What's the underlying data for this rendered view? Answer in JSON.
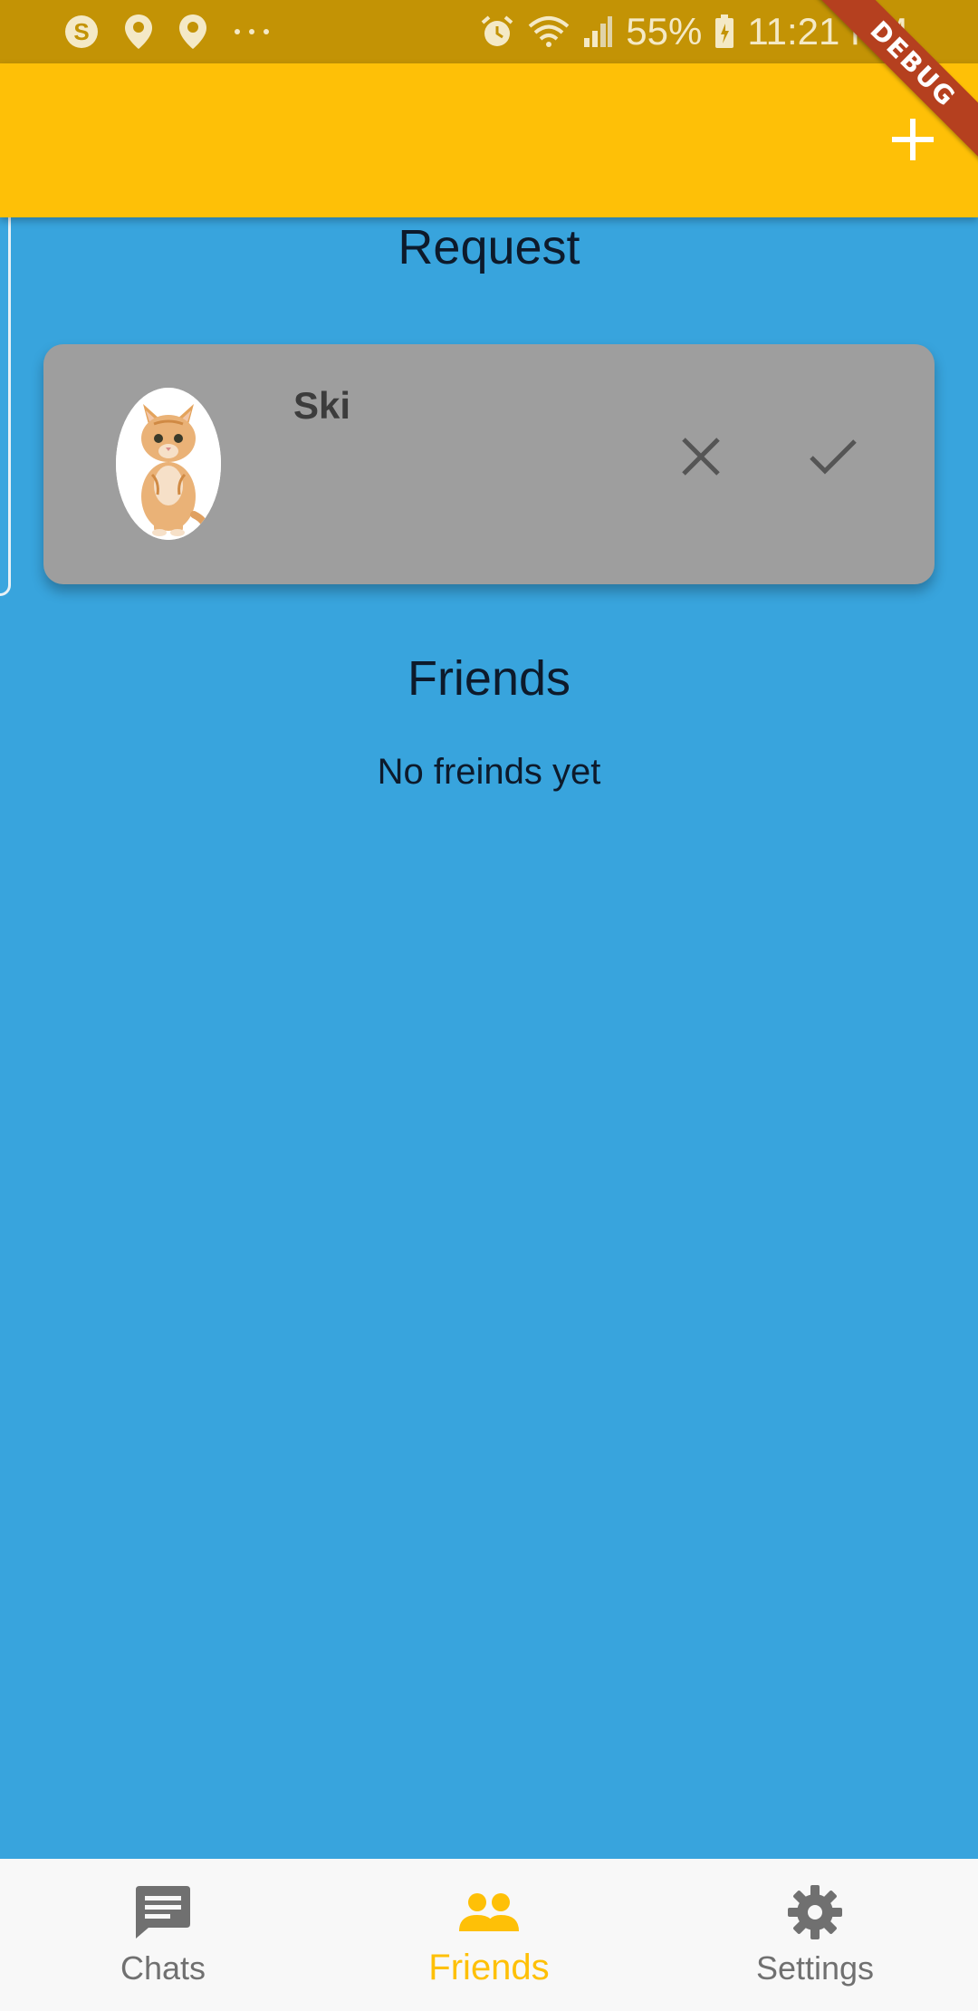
{
  "status_bar": {
    "battery": "55%",
    "time": "11:21 PM"
  },
  "debug_banner": "DEBUG",
  "app_bar": {
    "action_icon": "plus-icon"
  },
  "request_section": {
    "title": "Request",
    "items": [
      {
        "name": "Ski",
        "avatar": "cat-photo",
        "decline_icon": "close-icon",
        "accept_icon": "check-icon"
      }
    ]
  },
  "friends_section": {
    "title": "Friends",
    "empty_text": "No freinds yet"
  },
  "bottom_nav": {
    "items": [
      {
        "label": "Chats",
        "icon": "chat-icon",
        "active": false
      },
      {
        "label": "Friends",
        "icon": "people-icon",
        "active": true
      },
      {
        "label": "Settings",
        "icon": "gear-icon",
        "active": false
      }
    ]
  },
  "colors": {
    "background": "#38a4dd",
    "app_bar": "#fec007",
    "status_bar": "#c39305",
    "card": "#9e9e9e",
    "active_nav": "#fec007",
    "inactive_nav": "#707070"
  }
}
